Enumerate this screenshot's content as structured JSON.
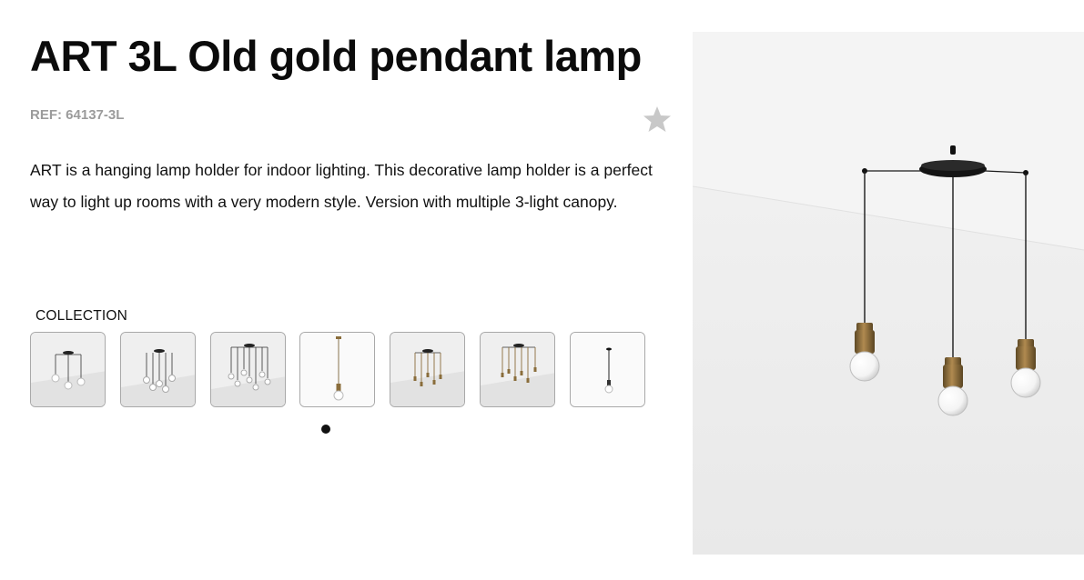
{
  "product": {
    "title": "ART 3L Old gold pendant lamp",
    "ref": "REF: 64137-3L",
    "description": "ART is a hanging lamp holder for indoor lighting. This decorative lamp holder is a perfect way to light up rooms with a very modern style. Version with multiple 3-light canopy."
  },
  "favorite": {
    "icon": "star-icon",
    "color": "#c8c8c8"
  },
  "collection": {
    "label": "COLLECTION",
    "thumbnails": [
      {
        "name": "thumb-art-3l"
      },
      {
        "name": "thumb-art-5l"
      },
      {
        "name": "thumb-art-7l"
      },
      {
        "name": "thumb-art-1l-gold"
      },
      {
        "name": "thumb-art-3l-gold"
      },
      {
        "name": "thumb-art-5l-gold"
      },
      {
        "name": "thumb-art-1l-black"
      }
    ],
    "pagination": {
      "pages": 1,
      "current": 1
    }
  },
  "colors": {
    "accent_gold": "#8a6d3b",
    "cable": "#1a1a1a",
    "background_gray": "#ebebeb"
  }
}
